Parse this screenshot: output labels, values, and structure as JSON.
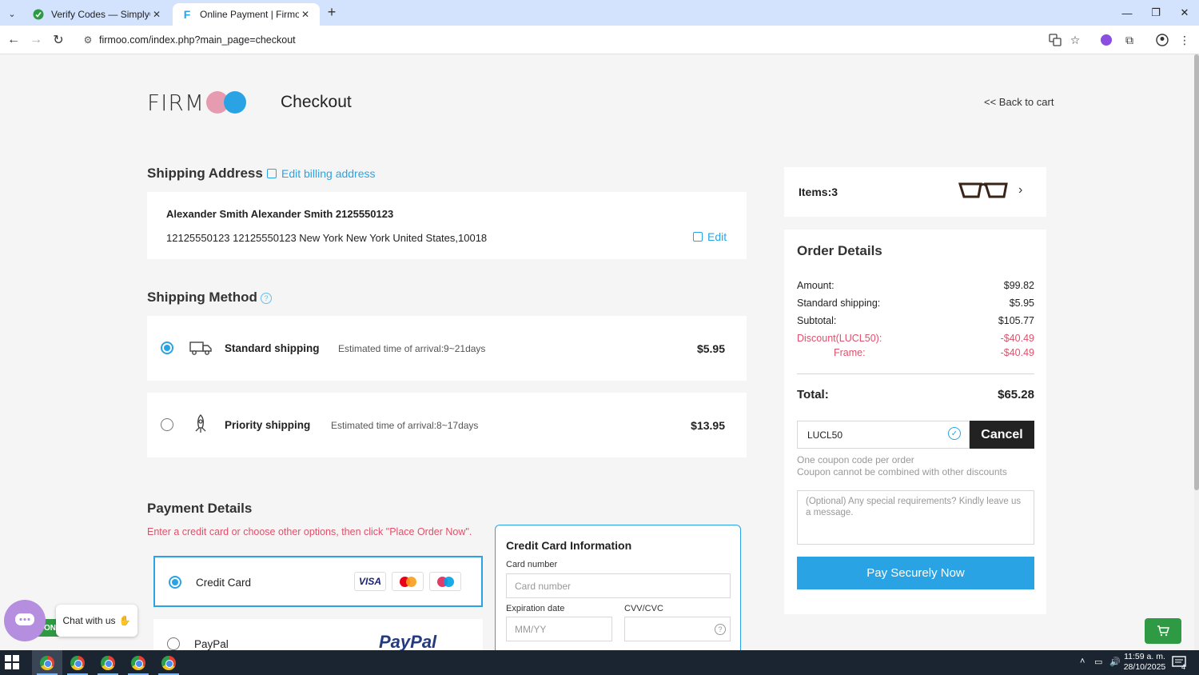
{
  "browser": {
    "tabs": [
      {
        "title": "Verify Codes — SimplyCodes",
        "active": false
      },
      {
        "title": "Online Payment | Firmoo.com",
        "active": true
      }
    ],
    "url": "firmoo.com/index.php?main_page=checkout"
  },
  "header": {
    "logo_text": "FIRM",
    "title": "Checkout",
    "back_link": "<< Back to cart"
  },
  "shipping_address": {
    "heading": "Shipping Address",
    "edit_billing": "Edit billing address",
    "name_line": "Alexander Smith Alexander Smith 2125550123",
    "address_line": "12125550123 12125550123 New York New York United States,10018",
    "edit_label": "Edit"
  },
  "shipping_method": {
    "heading": "Shipping Method",
    "help": "?",
    "options": [
      {
        "name": "Standard shipping",
        "eta": "Estimated time of arrival:9~21days",
        "price": "$5.95",
        "selected": true
      },
      {
        "name": "Priority shipping",
        "eta": "Estimated time of arrival:8~17days",
        "price": "$13.95",
        "selected": false
      }
    ]
  },
  "payment": {
    "heading": "Payment Details",
    "note": "Enter a credit card or choose other options, then click \"Place Order Now\".",
    "options": [
      {
        "label": "Credit Card",
        "selected": true,
        "logos": [
          "VISA",
          "mastercard",
          "maestro"
        ]
      },
      {
        "label": "PayPal",
        "selected": false,
        "logo": "PayPal"
      }
    ],
    "credit_card": {
      "title": "Credit Card Information",
      "card_number_label": "Card number",
      "card_number_placeholder": "Card number",
      "expiration_label": "Expiration date",
      "expiration_placeholder": "MM/YY",
      "cvv_label": "CVV/CVC",
      "cvv_help": "?"
    }
  },
  "summary": {
    "items_label": "Items:3",
    "order_details_title": "Order Details",
    "rows": [
      {
        "label": "Amount:",
        "value": "$99.82"
      },
      {
        "label": "Standard shipping:",
        "value": "$5.95"
      },
      {
        "label": "Subtotal:",
        "value": "$105.77"
      }
    ],
    "discount": {
      "label": "Discount(LUCL50):",
      "value": "-$40.49"
    },
    "frame": {
      "label": "Frame:",
      "value": "-$40.49"
    },
    "total_label": "Total:",
    "total_value": "$65.28",
    "coupon_code": "LUCL50",
    "cancel_label": "Cancel",
    "coupon_note_1": "One coupon code per order",
    "coupon_note_2": "Coupon cannot be combined with other discounts",
    "message_placeholder": "(Optional) Any special requirements? Kindly leave us a message.",
    "pay_button": "Pay Securely Now"
  },
  "chat": {
    "label": "Chat with us",
    "badge": "ON"
  },
  "taskbar": {
    "time": "11:59 a. m.",
    "date": "28/10/2025",
    "notification_count": "4"
  },
  "colors": {
    "accent": "#2aa3e5",
    "discount_red": "#e0506a",
    "logo_pink": "#e79bb0",
    "logo_blue": "#2aa3e5",
    "chat_green": "#2e9b44"
  }
}
